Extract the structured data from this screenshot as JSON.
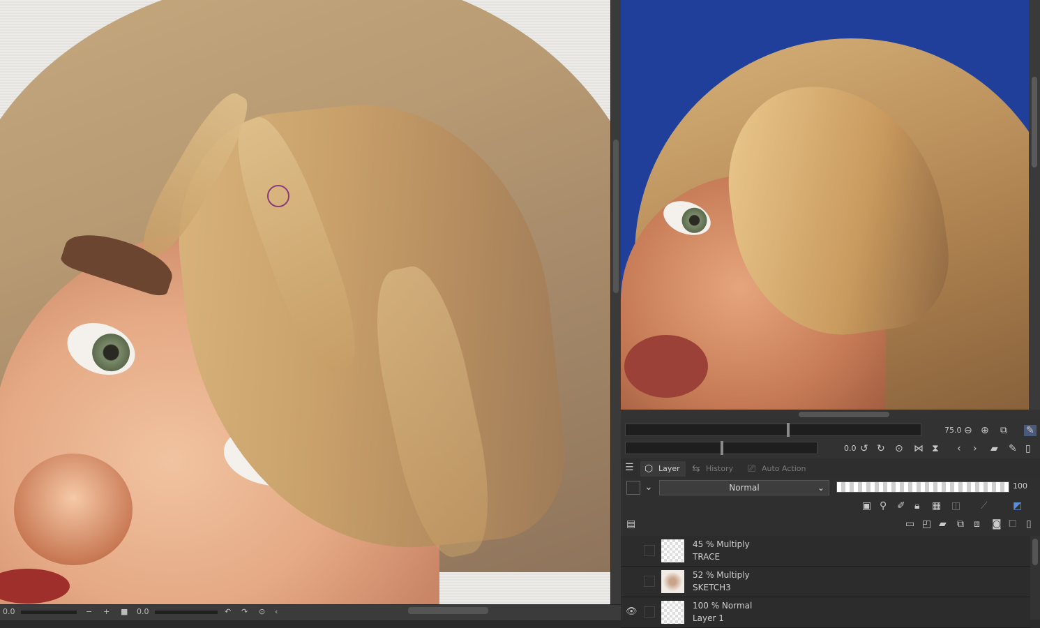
{
  "main_canvas": {
    "bottom_bar": {
      "left_value": "0.0",
      "rotation_value": "0.0"
    }
  },
  "navigator": {
    "zoom_value": "75.0",
    "rotate_value": "0.0"
  },
  "layer_panel": {
    "tabs": [
      {
        "label": "Layer",
        "icon": "layer-icon",
        "active": true
      },
      {
        "label": "History",
        "icon": "history-icon",
        "active": false
      },
      {
        "label": "Auto Action",
        "icon": "auto-action-icon",
        "active": false
      }
    ],
    "blend_mode": "Normal",
    "opacity": "100",
    "layers": [
      {
        "blend": "45 % Multiply",
        "name": "TRACE",
        "visible": false
      },
      {
        "blend": "52 % Multiply",
        "name": "SKETCH3",
        "visible": false
      },
      {
        "blend": "100 % Normal",
        "name": "Layer 1",
        "visible": true
      }
    ]
  },
  "colors": {
    "panel_bg": "#2b2b2b",
    "reference_bg": "#1f3f9a",
    "brush_cursor": "#8b3b7a"
  }
}
